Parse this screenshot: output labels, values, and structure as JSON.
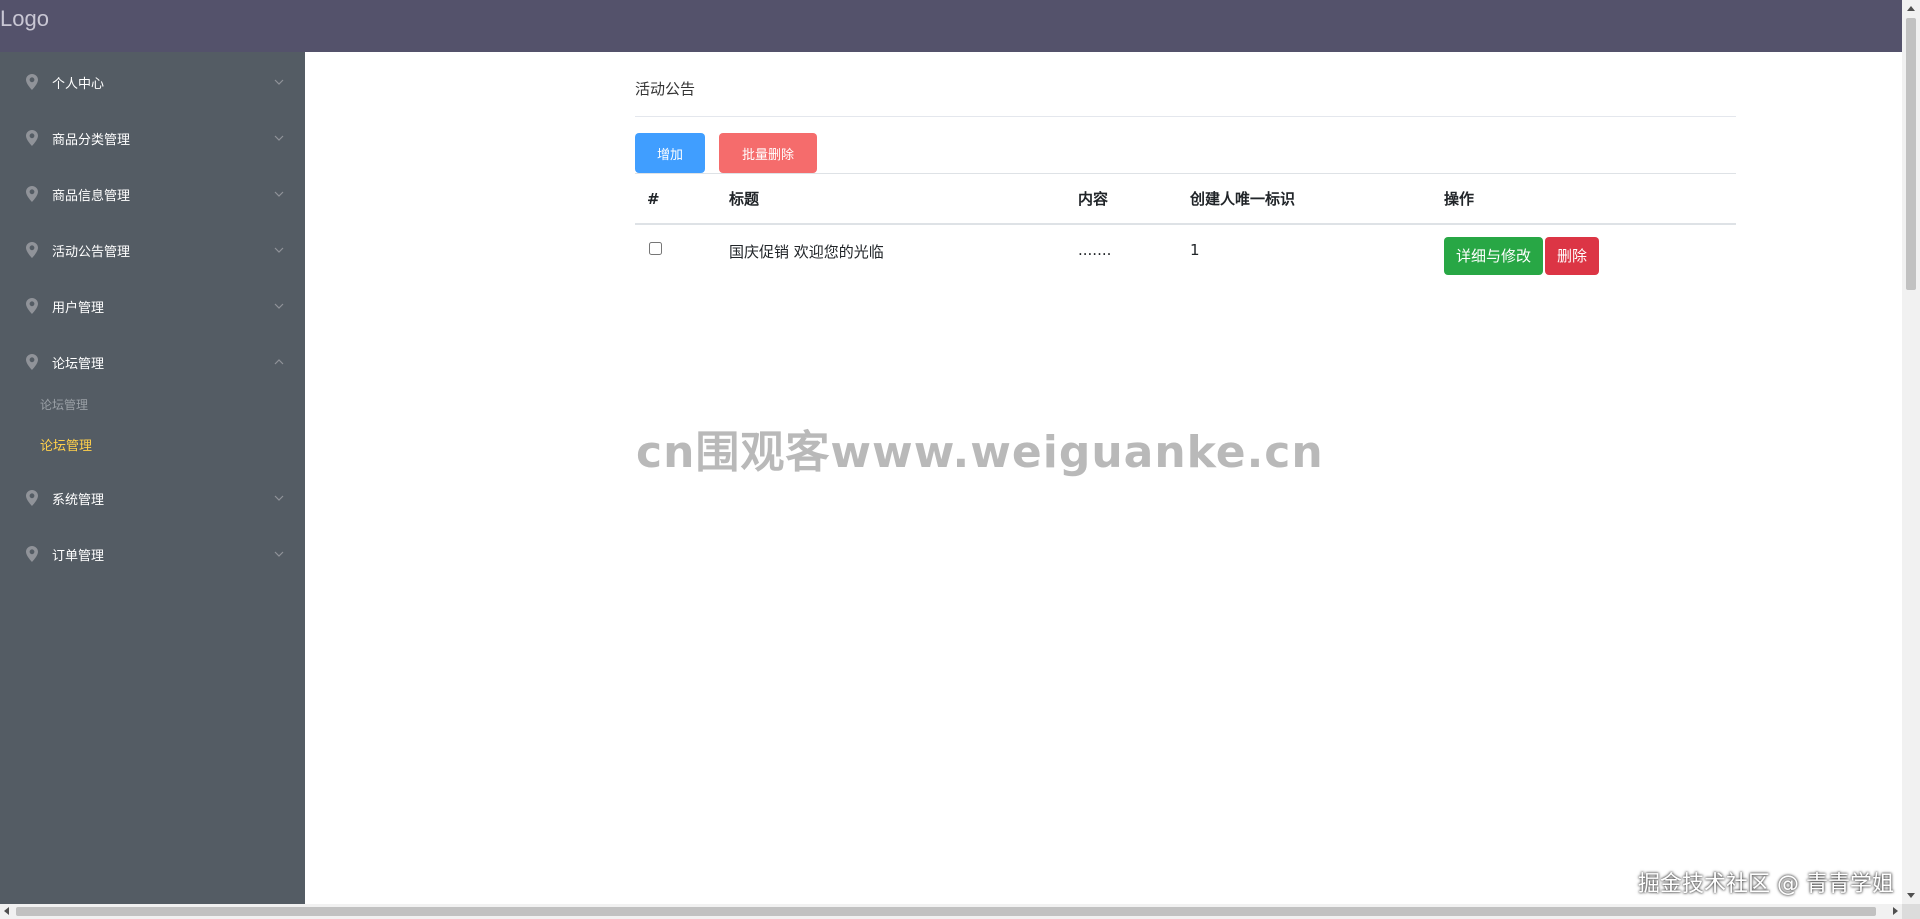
{
  "header": {
    "logo": "Logo"
  },
  "sidebar": {
    "items": [
      {
        "label": "个人中心",
        "expanded": false
      },
      {
        "label": "商品分类管理",
        "expanded": false
      },
      {
        "label": "商品信息管理",
        "expanded": false
      },
      {
        "label": "活动公告管理",
        "expanded": false
      },
      {
        "label": "用户管理",
        "expanded": false
      },
      {
        "label": "论坛管理",
        "expanded": true,
        "children": [
          {
            "label": "论坛管理",
            "state": "muted"
          },
          {
            "label": "论坛管理",
            "state": "active"
          }
        ]
      },
      {
        "label": "系统管理",
        "expanded": false
      },
      {
        "label": "订单管理",
        "expanded": false
      }
    ],
    "text_color": "#ffffff",
    "active_color": "#ffd04b",
    "bg_color": "#545c64"
  },
  "main": {
    "title": "活动公告",
    "toolbar": {
      "add_label": "增加",
      "batch_delete_label": "批量删除"
    },
    "table": {
      "columns": [
        "#",
        "标题",
        "内容",
        "创建人唯一标识",
        "操作"
      ],
      "rows": [
        {
          "checked": false,
          "title": "国庆促销 欢迎您的光临",
          "content": ".......",
          "creator": "1",
          "actions": {
            "edit_label": "详细与修改",
            "delete_label": "删除"
          }
        }
      ]
    }
  },
  "overlay": {
    "watermark": "cn围观客www.weiguanke.cn",
    "corner_mark": "掘金技术社区 @ 青青学姐"
  }
}
